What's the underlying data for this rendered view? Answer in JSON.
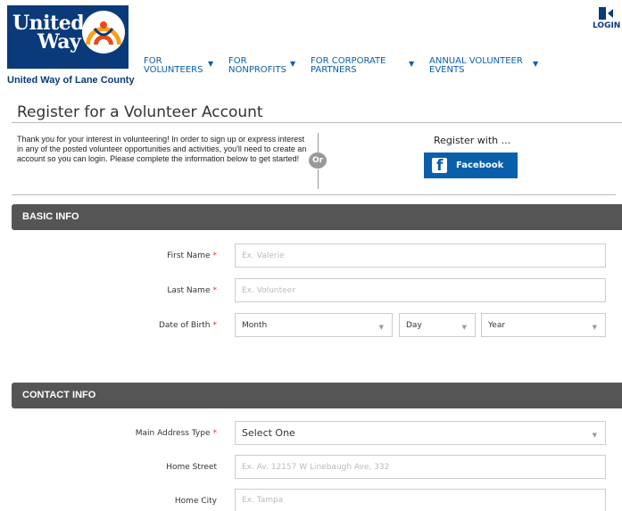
{
  "header": {
    "logo": {
      "word1": "United",
      "word2": "Way",
      "org_name": "United Way of Lane County"
    },
    "nav": [
      {
        "line1": "FOR",
        "line2": "VOLUNTEERS"
      },
      {
        "line1": "FOR",
        "line2": "NONPROFITS"
      },
      {
        "line1": "FOR CORPORATE",
        "line2": "PARTNERS"
      },
      {
        "line1": "ANNUAL VOLUNTEER",
        "line2": "EVENTS"
      }
    ],
    "login_label": "LOGIN",
    "brand_color": "#0a3a7a",
    "accent_color": "#0a5fab"
  },
  "register": {
    "title": "Register for a Volunteer Account",
    "intro": "Thank you for your interest in volunteering! In order to sign up or express interest in any of the posted volunteer opportunities and activities, you'll need to create an account so you can login. Please complete the information below to get started!",
    "or_label": "Or",
    "register_with": "Register with ...",
    "facebook_label": "Facebook"
  },
  "basic_info": {
    "title": "BASIC INFO",
    "first_name": {
      "label": "First Name",
      "placeholder": "Ex. Valerie"
    },
    "last_name": {
      "label": "Last Name",
      "placeholder": "Ex. Volunteer"
    },
    "dob": {
      "label": "Date of Birth",
      "month": "Month",
      "day": "Day",
      "year": "Year"
    },
    "required_mark": "*"
  },
  "contact_info": {
    "title": "CONTACT INFO",
    "address_type": {
      "label": "Main Address Type",
      "value": "Select One"
    },
    "home_street": {
      "label": "Home Street",
      "placeholder": "Ex. Av. 12157 W Linebaugh Ave, 332"
    },
    "home_city": {
      "label": "Home City",
      "placeholder": "Ex. Tampa"
    }
  }
}
